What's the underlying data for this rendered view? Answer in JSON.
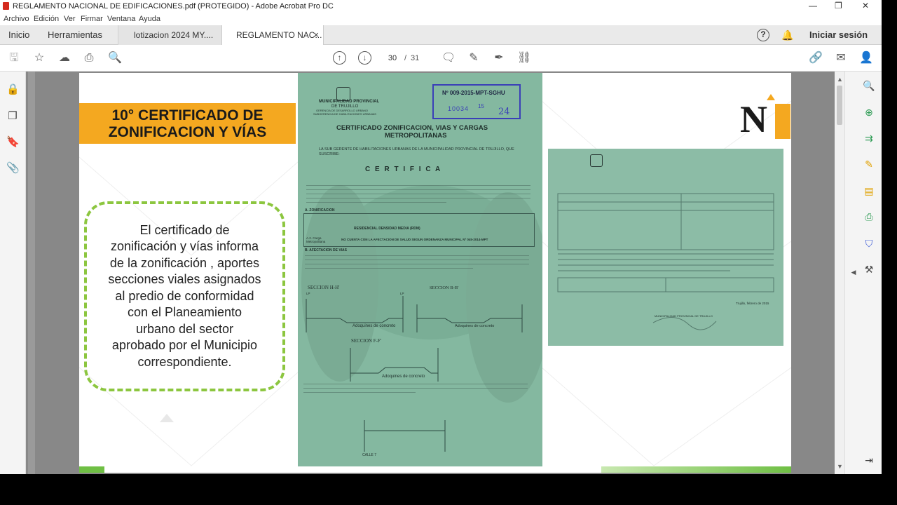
{
  "window": {
    "title": "REGLAMENTO NACIONAL DE EDIFICACIONES.pdf (PROTEGIDO) - Adobe Acrobat Pro DC",
    "minimize": "—",
    "maximize": "❐",
    "close": "✕"
  },
  "menu": [
    "Archivo",
    "Edición",
    "Ver",
    "Firmar",
    "Ventana",
    "Ayuda"
  ],
  "tabs": {
    "home": "Inicio",
    "tools": "Herramientas",
    "doc1": "lotizacion 2024 MY....",
    "doc2": "REGLAMENTO NAC...",
    "doc2_close": "×",
    "signin": "Iniciar sesión"
  },
  "toolbar": {
    "page_current": "30",
    "page_separator": "/",
    "page_total": "31"
  },
  "slide": {
    "heading_line1": "10° CERTIFICADO DE",
    "heading_line2": "ZONIFICACION Y VÍAS",
    "body": "El certificado de\nzonificación y vías informa\nde la zonificación , aportes\nsecciones viales asignados\nal predio de conformidad\ncon el Planeamiento\nurbano del sector\naprobado por el Municipio\ncorrespondiente.",
    "logo_letter": "N"
  },
  "doc1": {
    "stamp_no": "Nº 009-2015-MPT-SGHU",
    "stamp_num": "10034",
    "stamp_small": "15",
    "stamp_hand": "24",
    "muni_l1": "MUNICIPALIDAD PROVINCIAL",
    "muni_l2": "DE TRUJILLO",
    "muni_l3": "GERENCIA DE DESARROLLO URBANO",
    "muni_l4": "SUBGERENCIA DE HABILITACIONES URBANAS",
    "title_l1": "CERTIFICADO ZONIFICACION, VIAS Y CARGAS",
    "title_l2": "METROPOLITANAS",
    "intro": "LA SUB GERENTE DE HABILITACIONES URBANAS DE LA MUNICIPALIDAD PROVINCIAL DE TRUJILLO, QUE SUSCRIBE:",
    "certifica": "C E R T I F I C A",
    "sec_a": "A. ZONIFICACION",
    "a2_label": "A.2. Carga Metropolitana",
    "a2_value": "NO CUENTA CON LA AFECTACION DE SALUD SEGUN ORDENANZA MUNICIPAL Nº 045-2014-MPT",
    "a1_value": "RESIDENCIAL DENSIDAD MEDIA (RDM)",
    "sec_b": "B. AFECTACION DE VIAS",
    "seccion_h": "SECCION H-H'",
    "seccion_b": "SECCION B-B'",
    "seccion_f": "SECCION F-F'",
    "adoquines1": "Adoquines de concreto",
    "adoquines2": "Adoquines de concreto",
    "adoquines3": "Adoquines de concreto",
    "calle": "CALLE 7",
    "lp": "LP"
  },
  "doc2": {
    "city_date": "Trujillo, febrero de 2015",
    "muni": "MUNICIPALIDAD PROVINCIAL DE TRUJILLO"
  },
  "colors": {
    "banner": "#f4a820",
    "bubble_border": "#8cc63f",
    "doc_bg": "#84b8a0",
    "stamp": "#3a3fb8"
  }
}
